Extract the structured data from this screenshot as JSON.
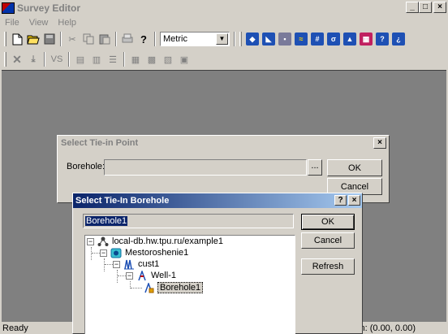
{
  "window": {
    "title": "Survey Editor",
    "minimize": "_",
    "maximize": "□",
    "close": "×"
  },
  "menu": [
    "File",
    "View",
    "Help"
  ],
  "toolbar": {
    "units_value": "Metric",
    "vs_label": "VS"
  },
  "status": {
    "left": "Ready",
    "coords": "n:  (0.00, 0.00)"
  },
  "tie_in_dialog": {
    "title": "Select Tie-in Point",
    "borehole_label": "Borehole:",
    "borehole_value": "",
    "browse_label": "...",
    "ok_label": "OK",
    "cancel_label": "Cancel",
    "close_label": "×"
  },
  "borehole_dialog": {
    "title": "Select Tie-In Borehole",
    "help_label": "?",
    "close_label": "×",
    "selected_value": "Borehole1",
    "ok_label": "OK",
    "cancel_label": "Cancel",
    "refresh_label": "Refresh",
    "tree": {
      "root": "local-db.hw.tpu.ru/example1",
      "field": "Mestoroshenie1",
      "cluster": "cust1",
      "well": "Well-1",
      "borehole": "Borehole1"
    }
  }
}
